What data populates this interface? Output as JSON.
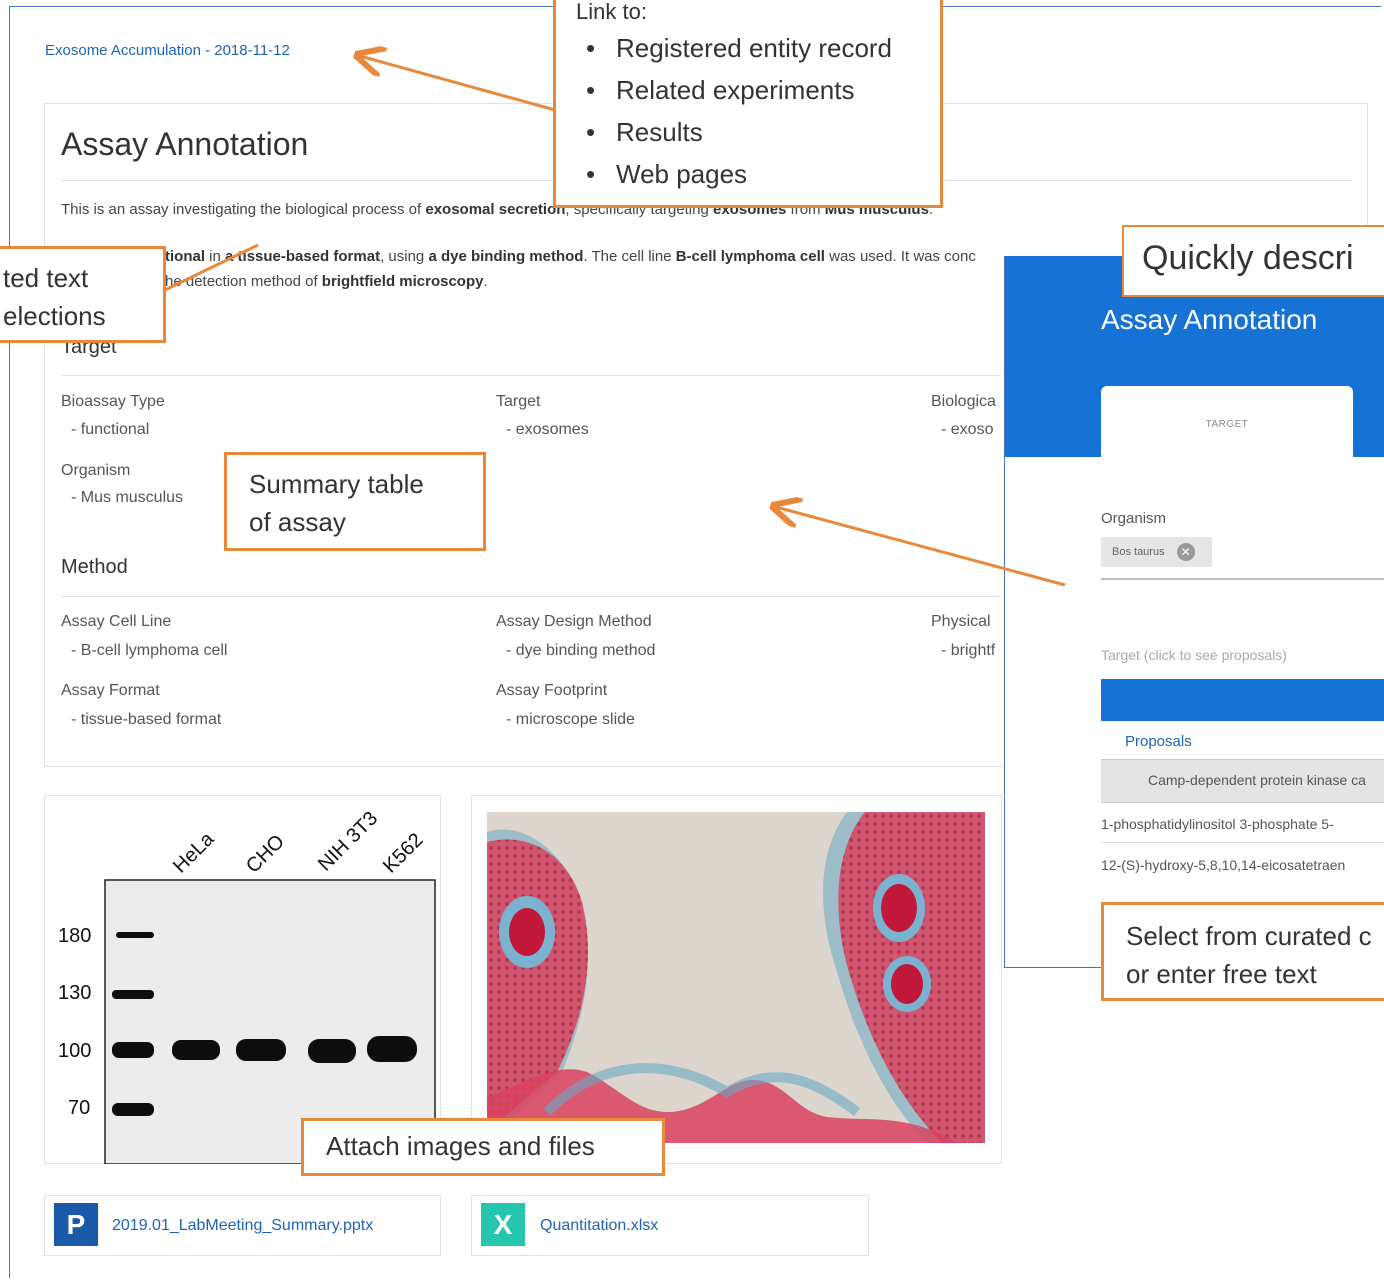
{
  "breadcrumb": "Exosome Accumulation - 2018-11-12",
  "annotation": {
    "title": "Assay Annotation",
    "para1": {
      "p1": "This is an assay investigating the biological process of ",
      "b1": "exosomal secretion",
      "p2": ", specifically targeting ",
      "b2": "exosomes",
      "p3": " from ",
      "b3": "Mus musculus",
      "p4": "."
    },
    "para2": {
      "b1": "tional",
      "p1": " in ",
      "b2": "a tissue-based format",
      "p2": ", using ",
      "b3": "a dye binding method",
      "p3": ". The cell line ",
      "b4": "B-cell lymphoma cell",
      "p4": " was used. It was conc"
    },
    "para3": {
      "p1": "he detection method of ",
      "b1": "brightfield microscopy",
      "p2": "."
    },
    "target_section": {
      "heading": "Target",
      "fields": [
        {
          "label": "Bioassay Type",
          "value": "- functional"
        },
        {
          "label": "Target",
          "value": "- exosomes"
        },
        {
          "label": "Biologica",
          "value": "- exoso"
        },
        {
          "label": "Organism",
          "value": "- Mus musculus"
        }
      ]
    },
    "method_section": {
      "heading": "Method",
      "fields": [
        {
          "label": "Assay Cell Line",
          "value": "- B-cell lymphoma cell"
        },
        {
          "label": "Assay Design Method",
          "value": "- dye binding method"
        },
        {
          "label": "Physical",
          "value": "- brightf"
        },
        {
          "label": "Assay Format",
          "value": "- tissue-based format"
        },
        {
          "label": "Assay Footprint",
          "value": "- microscope slide"
        }
      ]
    }
  },
  "blot": {
    "lanes": [
      "HeLa",
      "CHO",
      "NIH 3T3",
      "K562"
    ],
    "markers": [
      "180",
      "130",
      "100",
      "70"
    ]
  },
  "files": [
    {
      "name": "2019.01_LabMeeting_Summary.pptx",
      "icon_letter": "P",
      "icon_color": "#1a5aa8"
    },
    {
      "name": "Quantitation.xlsx",
      "icon_letter": "X",
      "icon_color": "#26c6ae"
    }
  ],
  "callouts": {
    "link_to": {
      "title": "Link to:",
      "items": [
        "Registered entity record",
        "Related experiments",
        "Results",
        "Web pages"
      ]
    },
    "curated_text": {
      "line1": "ted text",
      "line2": "elections"
    },
    "summary_table": {
      "line1": "Summary table",
      "line2": "of assay"
    },
    "attach": "Attach images and files",
    "quickly": "Quickly descri",
    "select_from": {
      "line1": "Select from curated c",
      "line2": "or enter free text"
    }
  },
  "mobile": {
    "title": "Assay Annotation",
    "tab": "TARGET",
    "organism_label": "Organism",
    "organism_chip": "Bos taurus",
    "target_placeholder": "Target (click to see proposals)",
    "proposals_label": "Proposals",
    "proposals": [
      "Camp-dependent protein kinase ca",
      "1-phosphatidylinositol 3-phosphate 5-",
      "12-(S)-hydroxy-5,8,10,14-eicosatetraen"
    ]
  },
  "colors": {
    "callout_border": "#e8883a",
    "frame_blue": "#4a72b8",
    "mobile_blue": "#1672d4",
    "link_blue": "#1f63b5"
  }
}
